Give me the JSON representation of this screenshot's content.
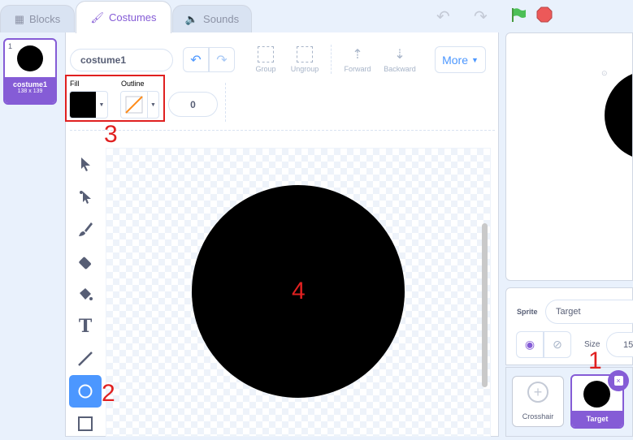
{
  "tabs": {
    "code": "Blocks",
    "costumes": "Costumes",
    "sounds": "Sounds"
  },
  "costume_list": [
    {
      "index": "1",
      "name": "costume1",
      "size": "138 x 139"
    }
  ],
  "editor": {
    "costume_name": "costume1",
    "group": "Group",
    "ungroup": "Ungroup",
    "forward": "Forward",
    "backward": "Backward",
    "more": "More",
    "fill_label": "Fill",
    "outline_label": "Outline",
    "outline_width": "0"
  },
  "tools": [
    "select-icon",
    "reshape-icon",
    "brush-icon",
    "eraser-icon",
    "fill-icon",
    "text-icon",
    "line-icon",
    "circle-icon",
    "rectangle-icon"
  ],
  "sprite_info": {
    "sprite_label": "Sprite",
    "sprite_name": "Target",
    "size_label": "Size",
    "size_value": "15"
  },
  "sprites": [
    {
      "name": "Crosshair"
    },
    {
      "name": "Target"
    }
  ],
  "annotations": [
    "1",
    "2",
    "3",
    "4"
  ],
  "colors": {
    "accent": "#855cd6",
    "blue": "#4c97ff",
    "fill": "#000000",
    "outline": "#ff8c1a",
    "flag": "#4cbf56",
    "stop": "#ec5959"
  }
}
